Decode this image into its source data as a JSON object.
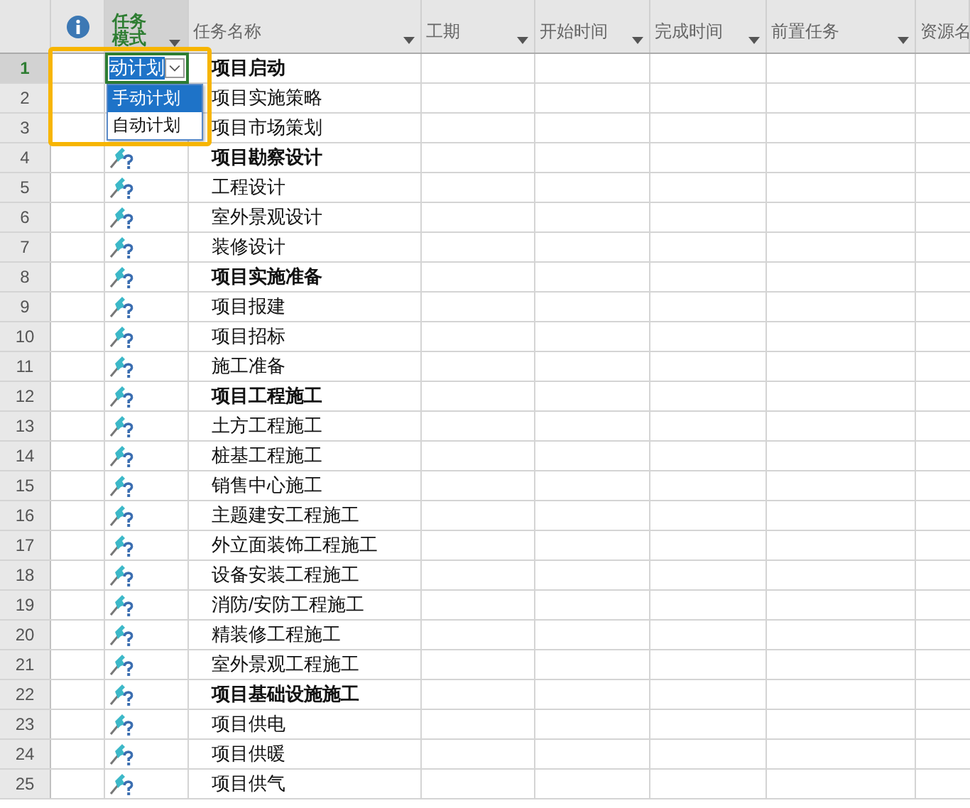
{
  "columns": [
    {
      "kind": "info"
    },
    {
      "kind": "mode",
      "label": "任务模式"
    },
    {
      "kind": "text",
      "label": "任务名称"
    },
    {
      "kind": "text",
      "label": "工期"
    },
    {
      "kind": "text",
      "label": "开始时间"
    },
    {
      "kind": "text",
      "label": "完成时间"
    },
    {
      "kind": "text",
      "label": "前置任务"
    },
    {
      "kind": "text",
      "label": "资源名"
    }
  ],
  "editor": {
    "value": "动计划",
    "options": [
      {
        "label": "手动计划",
        "selected": true
      },
      {
        "label": "自动计划",
        "selected": false
      }
    ]
  },
  "rows": [
    {
      "number": "1",
      "name": "项目启动",
      "summary": true,
      "selected": true
    },
    {
      "number": "2",
      "name": "项目实施策略",
      "summary": false,
      "selected": false
    },
    {
      "number": "3",
      "name": "项目市场策划",
      "summary": false,
      "selected": false
    },
    {
      "number": "4",
      "name": "项目勘察设计",
      "summary": true,
      "selected": false,
      "mode_icon": true
    },
    {
      "number": "5",
      "name": "工程设计",
      "summary": false,
      "selected": false,
      "mode_icon": true
    },
    {
      "number": "6",
      "name": "室外景观设计",
      "summary": false,
      "selected": false,
      "mode_icon": true
    },
    {
      "number": "7",
      "name": "装修设计",
      "summary": false,
      "selected": false,
      "mode_icon": true
    },
    {
      "number": "8",
      "name": "项目实施准备",
      "summary": true,
      "selected": false,
      "mode_icon": true
    },
    {
      "number": "9",
      "name": "项目报建",
      "summary": false,
      "selected": false,
      "mode_icon": true
    },
    {
      "number": "10",
      "name": "项目招标",
      "summary": false,
      "selected": false,
      "mode_icon": true
    },
    {
      "number": "11",
      "name": "施工准备",
      "summary": false,
      "selected": false,
      "mode_icon": true
    },
    {
      "number": "12",
      "name": "项目工程施工",
      "summary": true,
      "selected": false,
      "mode_icon": true
    },
    {
      "number": "13",
      "name": "土方工程施工",
      "summary": false,
      "selected": false,
      "mode_icon": true
    },
    {
      "number": "14",
      "name": "桩基工程施工",
      "summary": false,
      "selected": false,
      "mode_icon": true
    },
    {
      "number": "15",
      "name": "销售中心施工",
      "summary": false,
      "selected": false,
      "mode_icon": true
    },
    {
      "number": "16",
      "name": "主题建安工程施工",
      "summary": false,
      "selected": false,
      "mode_icon": true
    },
    {
      "number": "17",
      "name": "外立面装饰工程施工",
      "summary": false,
      "selected": false,
      "mode_icon": true
    },
    {
      "number": "18",
      "name": "设备安装工程施工",
      "summary": false,
      "selected": false,
      "mode_icon": true
    },
    {
      "number": "19",
      "name": "消防/安防工程施工",
      "summary": false,
      "selected": false,
      "mode_icon": true
    },
    {
      "number": "20",
      "name": "精装修工程施工",
      "summary": false,
      "selected": false,
      "mode_icon": true
    },
    {
      "number": "21",
      "name": "室外景观工程施工",
      "summary": false,
      "selected": false,
      "mode_icon": true
    },
    {
      "number": "22",
      "name": "项目基础设施施工",
      "summary": true,
      "selected": false,
      "mode_icon": true
    },
    {
      "number": "23",
      "name": "项目供电",
      "summary": false,
      "selected": false,
      "mode_icon": true
    },
    {
      "number": "24",
      "name": "项目供暖",
      "summary": false,
      "selected": false,
      "mode_icon": true
    },
    {
      "number": "25",
      "name": "项目供气",
      "summary": false,
      "selected": false,
      "mode_icon": true
    }
  ]
}
